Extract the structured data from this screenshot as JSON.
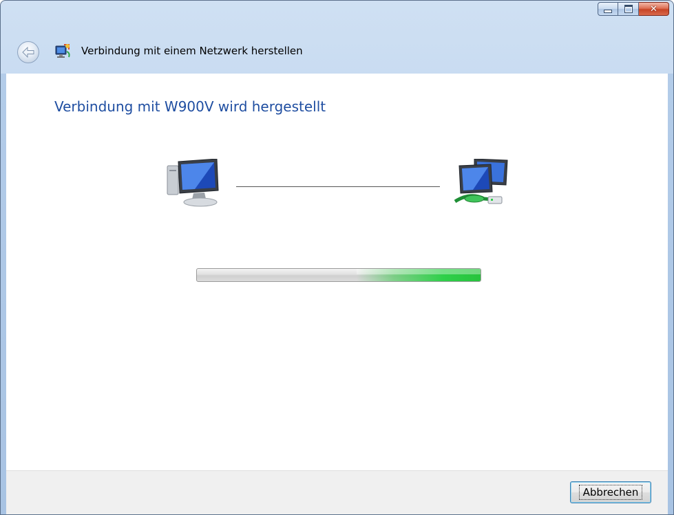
{
  "window": {
    "title": "Verbindung mit einem Netzwerk herstellen",
    "controls": {
      "minimize_icon": "minimize-icon",
      "maximize_icon": "maximize-icon",
      "close_icon": "close-icon",
      "close_glyph": "✕"
    },
    "back_icon": "back-arrow-icon",
    "app_icon": "network-wizard-icon"
  },
  "main": {
    "heading": "Verbindung mit W900V wird hergestellt",
    "source_icon": "computer-icon",
    "target_icon": "network-icon",
    "progress": {
      "mode": "indeterminate",
      "pulse_position": 0.72
    }
  },
  "footer": {
    "cancel_label": "Abbrechen"
  },
  "colors": {
    "heading": "#1f4ea1",
    "progress_fill": "#2fd04a",
    "title_bar": "#bcd3ee",
    "close_button": "#c74426"
  }
}
